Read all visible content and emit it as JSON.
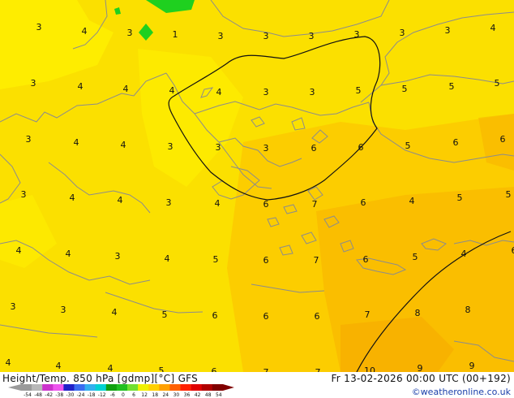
{
  "map": {
    "values": [
      "3",
      "4",
      "3",
      "1",
      "3",
      "3",
      "3",
      "3",
      "3",
      "3",
      "4",
      "3",
      "4",
      "4",
      "4",
      "4",
      "3",
      "3",
      "5",
      "5",
      "5",
      "5",
      "3",
      "4",
      "4",
      "3",
      "3",
      "3",
      "6",
      "6",
      "5",
      "6",
      "6",
      "3",
      "4",
      "4",
      "3",
      "4",
      "6",
      "7",
      "6",
      "4",
      "5",
      "5",
      "4",
      "4",
      "3",
      "4",
      "5",
      "6",
      "7",
      "6",
      "5",
      "4",
      "6",
      "3",
      "3",
      "4",
      "5",
      "6",
      "6",
      "6",
      "7",
      "8",
      "8",
      "4",
      "4",
      "4",
      "5",
      "6",
      "7",
      "7",
      "10",
      "9",
      "9"
    ]
  },
  "footer": {
    "title": "Height/Temp. 850 hPa [gdmp][°C] GFS",
    "datetime": "Fr 13-02-2026 00:00 UTC (00+192)",
    "credit": "©weatheronline.co.uk"
  },
  "colorbar": {
    "ticks": [
      "-54",
      "-48",
      "-42",
      "-38",
      "-30",
      "-24",
      "-18",
      "-12",
      "-6",
      "0",
      "6",
      "12",
      "18",
      "24",
      "30",
      "36",
      "42",
      "48",
      "54"
    ],
    "colors": [
      "#9a9a9a",
      "#b8b8b8",
      "#cc33cc",
      "#ee55ee",
      "#2020c8",
      "#3a6cf0",
      "#33b0ee",
      "#00d2d2",
      "#10a010",
      "#20c020",
      "#70e030",
      "#f0f000",
      "#ffd000",
      "#ffa000",
      "#ff6000",
      "#ff2000",
      "#e00000",
      "#b00000",
      "#800000"
    ],
    "field_colors": {
      "base": "#fbe000",
      "lighter": "#fff200",
      "warm": "#fcc500",
      "warmer": "#f9b400",
      "green": "#1fd01f"
    }
  }
}
